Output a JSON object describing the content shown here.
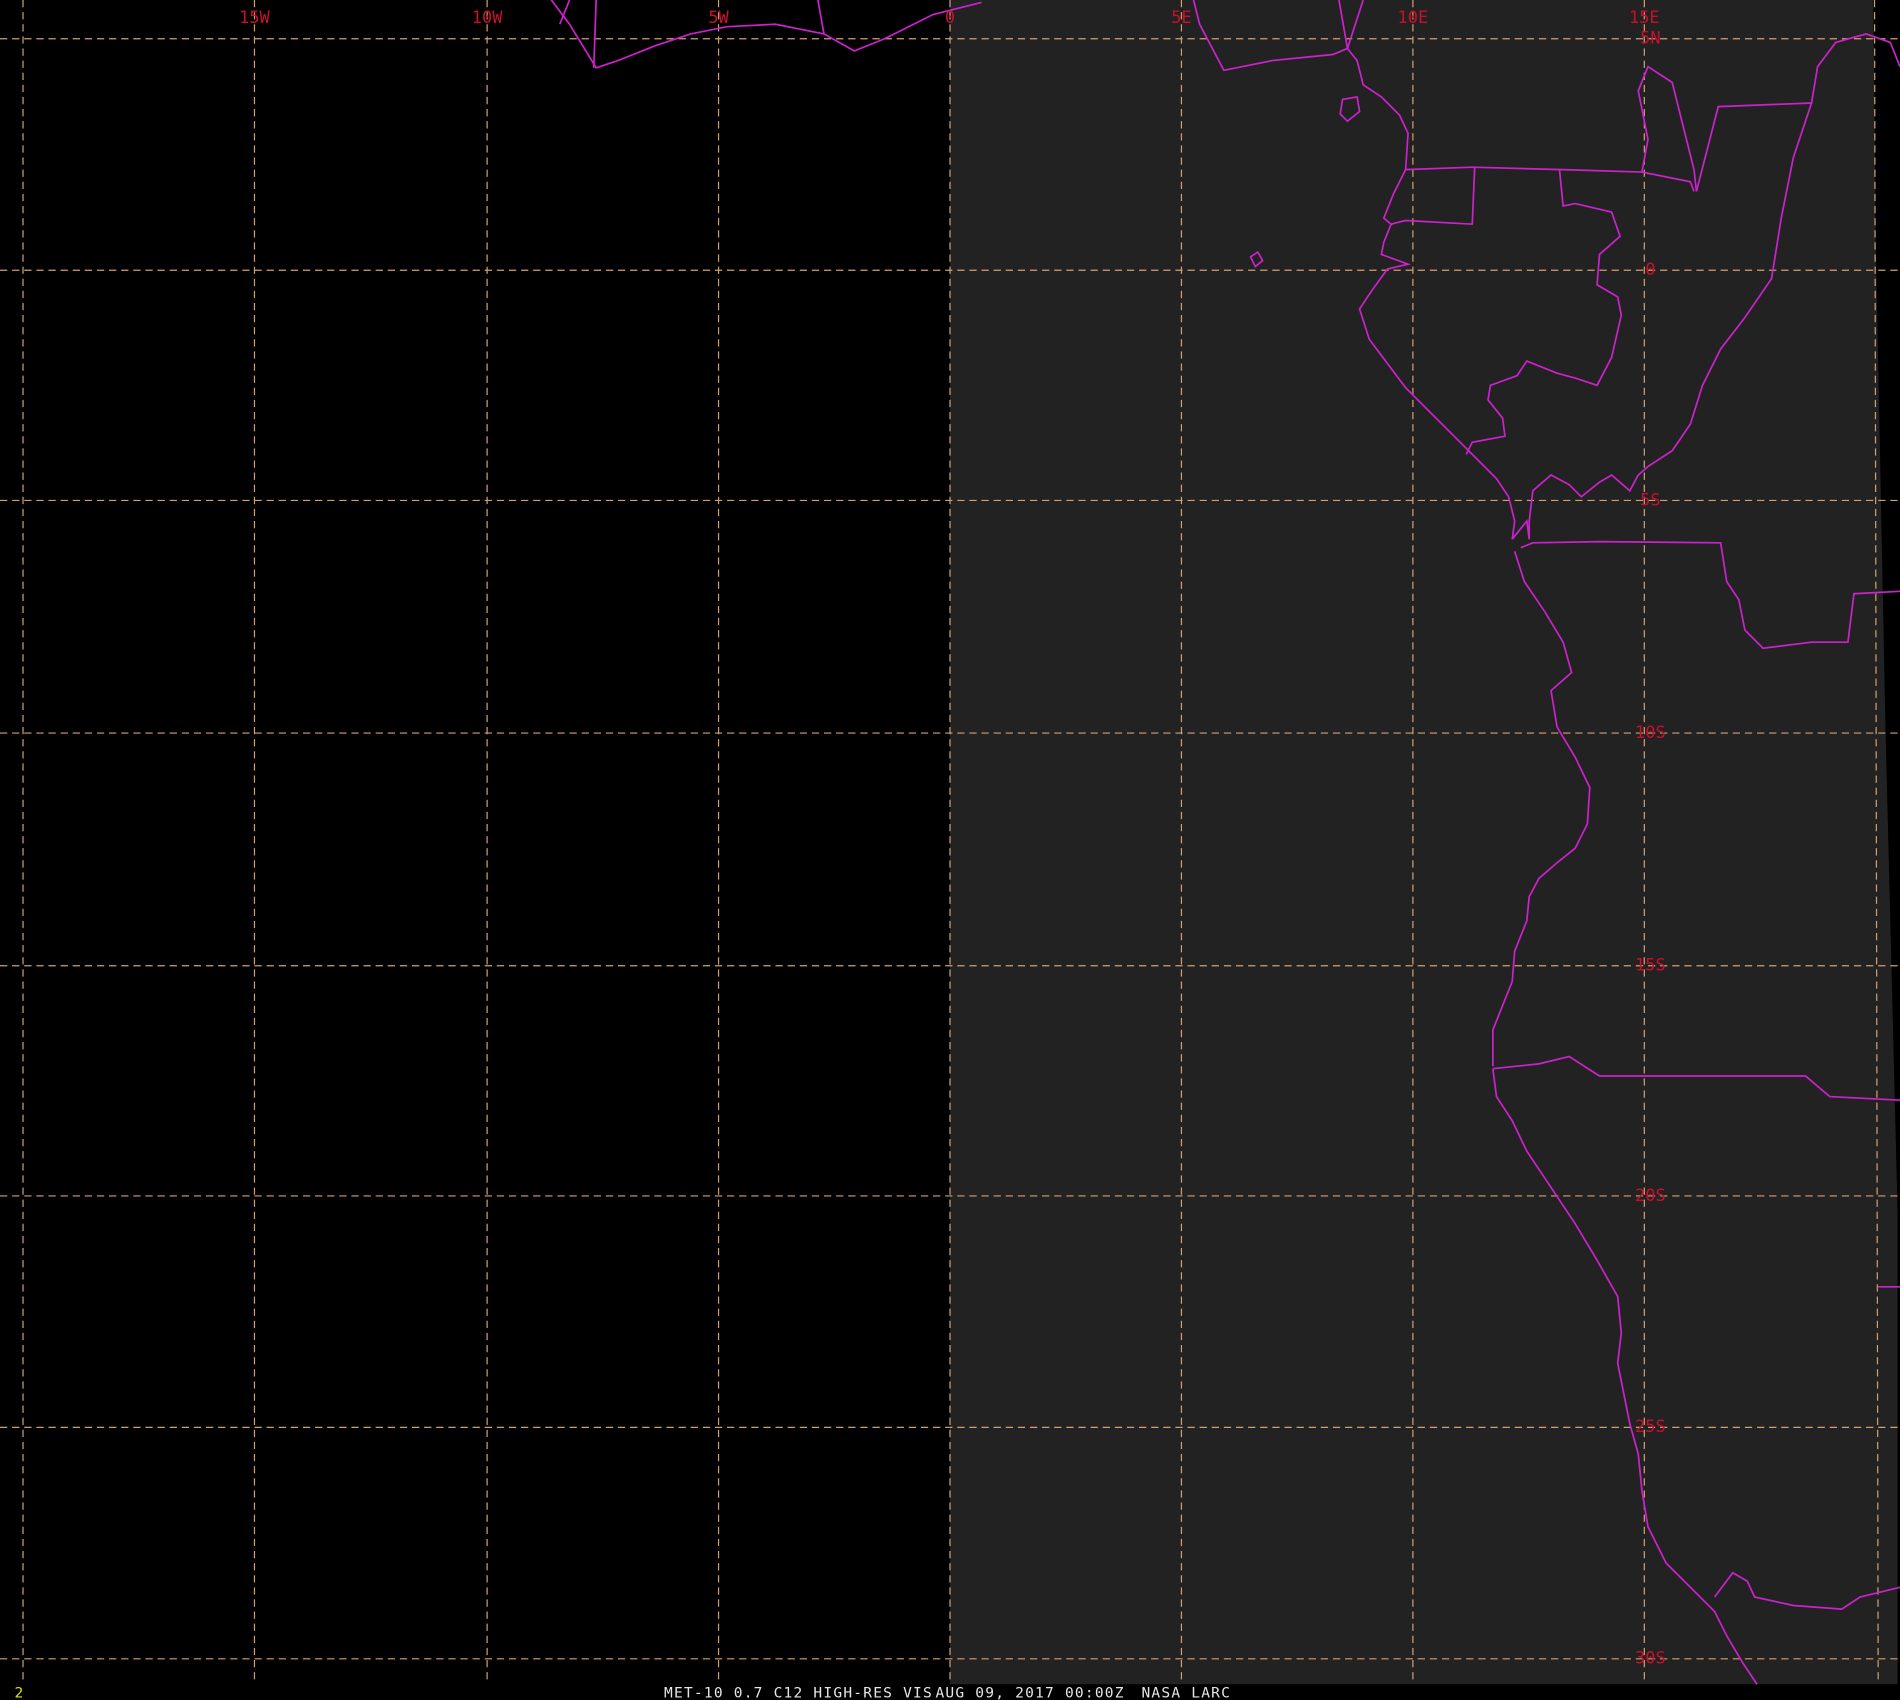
{
  "map": {
    "colors": {
      "background_space": "#000000",
      "earth_disk": "#222222",
      "gridline": "#d2a070",
      "coastline": "#cc22cc",
      "grid_label": "#c8102e",
      "footer_text": "#e6e6e6",
      "corner_text": "#e6e000"
    },
    "longitude_labels": [
      "15W",
      "10W",
      "5W",
      "0",
      "5E",
      "10E",
      "15E"
    ],
    "latitude_labels": [
      "5N",
      "0",
      "5S",
      "10S",
      "15S",
      "20S",
      "25S",
      "30S"
    ],
    "footer": {
      "product": "MET-10 0.7 C12 HIGH-RES VIS",
      "timestamp": "AUG 09, 2017 00:00Z",
      "source": "NASA LARC"
    },
    "frame_number": "2"
  }
}
